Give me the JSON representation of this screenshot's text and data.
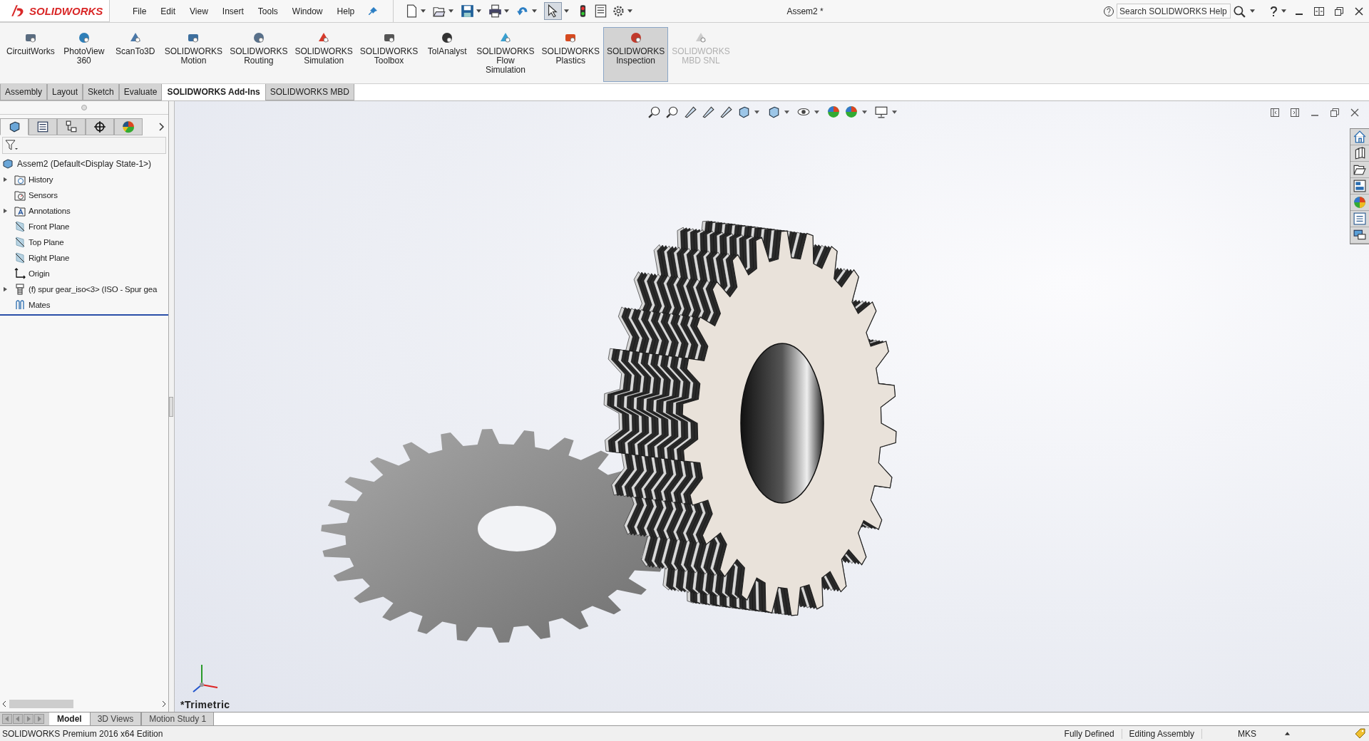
{
  "app": {
    "logo": "SOLIDWORKS",
    "menu": [
      "File",
      "Edit",
      "View",
      "Insert",
      "Tools",
      "Window",
      "Help"
    ],
    "title": "Assem2 *",
    "search": {
      "placeholder": "Search SOLIDWORKS Help"
    }
  },
  "ribbon": [
    {
      "lines": [
        "CircuitWorks"
      ],
      "selected": false,
      "disabled": false
    },
    {
      "lines": [
        "PhotoView",
        "360"
      ],
      "selected": false,
      "disabled": false
    },
    {
      "lines": [
        "ScanTo3D"
      ],
      "selected": false,
      "disabled": false
    },
    {
      "lines": [
        "SOLIDWORKS",
        "Motion"
      ],
      "selected": false,
      "disabled": false
    },
    {
      "lines": [
        "SOLIDWORKS",
        "Routing"
      ],
      "selected": false,
      "disabled": false
    },
    {
      "lines": [
        "SOLIDWORKS",
        "Simulation"
      ],
      "selected": false,
      "disabled": false
    },
    {
      "lines": [
        "SOLIDWORKS",
        "Toolbox"
      ],
      "selected": false,
      "disabled": false
    },
    {
      "lines": [
        "TolAnalyst"
      ],
      "selected": false,
      "disabled": false
    },
    {
      "lines": [
        "SOLIDWORKS",
        "Flow",
        "Simulation"
      ],
      "selected": false,
      "disabled": false
    },
    {
      "lines": [
        "SOLIDWORKS",
        "Plastics"
      ],
      "selected": false,
      "disabled": false
    },
    {
      "lines": [
        "SOLIDWORKS",
        "Inspection"
      ],
      "selected": true,
      "disabled": false
    },
    {
      "lines": [
        "SOLIDWORKS",
        "MBD SNL"
      ],
      "selected": false,
      "disabled": true
    }
  ],
  "tabs": [
    {
      "label": "Assembly",
      "selected": false
    },
    {
      "label": "Layout",
      "selected": false
    },
    {
      "label": "Sketch",
      "selected": false
    },
    {
      "label": "Evaluate",
      "selected": false
    },
    {
      "label": "SOLIDWORKS Add-Ins",
      "selected": true
    },
    {
      "label": "SOLIDWORKS MBD",
      "selected": false
    }
  ],
  "feature_manager": {
    "panel_tabs": [
      {
        "selected": true
      },
      {
        "selected": false
      },
      {
        "selected": false
      },
      {
        "selected": false
      },
      {
        "selected": false
      }
    ],
    "tree": {
      "label": "Assem2  (Default<Display State-1>)",
      "children": [
        {
          "label": "History",
          "kind": "history",
          "expanded": false
        },
        {
          "label": "Sensors",
          "kind": "sensors"
        },
        {
          "label": "Annotations",
          "kind": "annotations",
          "expanded": false
        },
        {
          "label": "Front Plane",
          "kind": "plane"
        },
        {
          "label": "Top Plane",
          "kind": "plane"
        },
        {
          "label": "Right Plane",
          "kind": "plane"
        },
        {
          "label": "Origin",
          "kind": "origin"
        },
        {
          "label": "(f) spur gear_iso<3> (ISO - Spur gea",
          "kind": "part",
          "expanded": false
        },
        {
          "label": "Mates",
          "kind": "mates"
        }
      ]
    }
  },
  "viewport": {
    "view_label": "*Trimetric"
  },
  "bottom_tabs": [
    {
      "label": "Model",
      "selected": true
    },
    {
      "label": "3D Views",
      "selected": false
    },
    {
      "label": "Motion Study 1",
      "selected": false
    }
  ],
  "status_bar": {
    "edition": "SOLIDWORKS Premium 2016 x64 Edition",
    "fields": [
      "Fully Defined",
      "Editing Assembly",
      "MKS"
    ]
  }
}
